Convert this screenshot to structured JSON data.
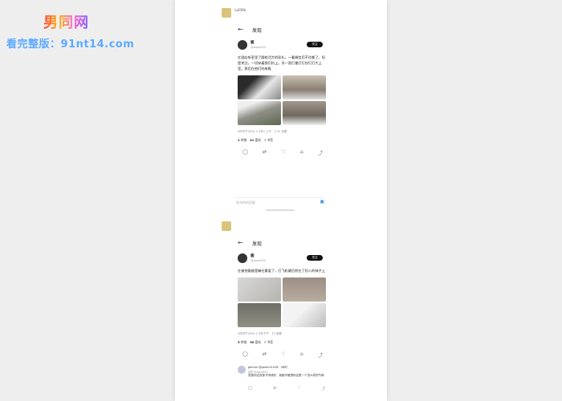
{
  "watermark": {
    "logo": "男同网",
    "url": "看完整版：91nt14.com"
  },
  "post1": {
    "header_title": "发现",
    "author_name": "鹿",
    "author_handle": "@aqua450",
    "follow_label": "关注",
    "text": "在酒店听室里了跟校活大的彩礼，一看微信后不往都了。但是关注。一切穿着我们趴上。另一直打量打打扮打打大上室。那后在他们的来鞋",
    "meta": "2时中午2024 1.5年1 上午 · 3.22 查看",
    "stats": {
      "reposts_count": "1",
      "reposts_label": "转推",
      "likes_count": "31",
      "likes_label": "喜欢",
      "bookmarks": "3 书签"
    },
    "reply_placeholder": "发布你的回复"
  },
  "post2": {
    "header_title": "发现",
    "author_name": "鹿",
    "author_handle": "@aqua450",
    "follow_label": "关注",
    "text": "在被他看被是嘛在最爱了，打飞机最后射在了别人的袜子上",
    "meta": "2时中午2024 1.5年下午 · 75 查看",
    "stats": {
      "reposts_count": "3",
      "reposts_label": "转推",
      "likes_count": "30",
      "likes_label": "喜欢",
      "bookmarks": "3 书签"
    },
    "reply": {
      "name": "gemini @gemini1416 · 28时",
      "to": "回复 @aqua450",
      "text": "发我你这双袜子呀请好，我都不敢想你这是一个怎么样的气味"
    }
  }
}
